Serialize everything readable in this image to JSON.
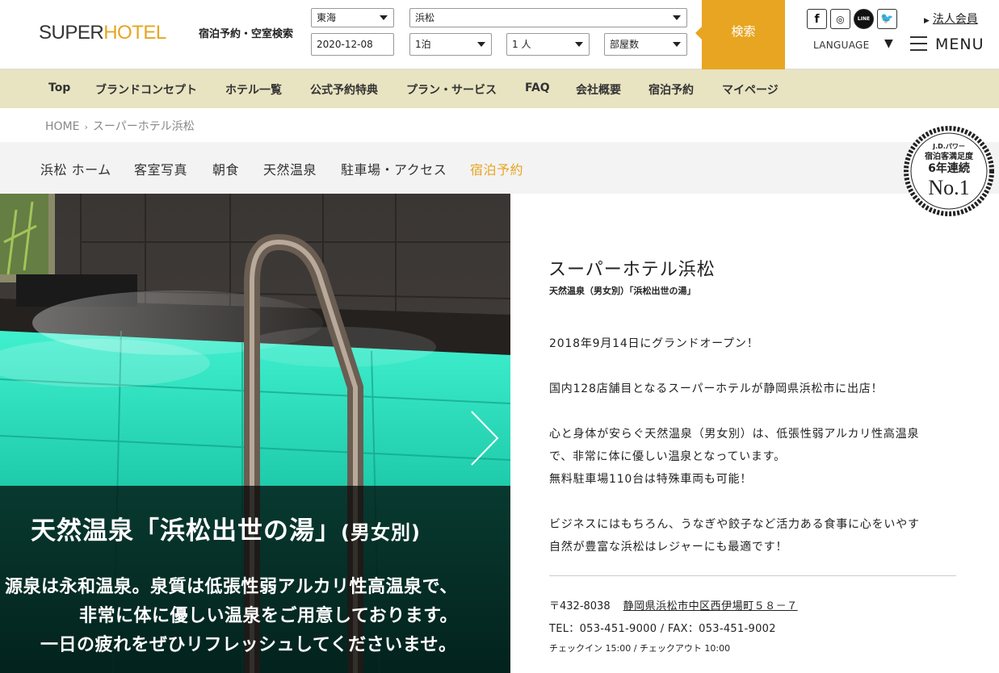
{
  "header": {
    "logo_main": "SUPER",
    "logo_accent": "HOTEL",
    "search_label": "宿泊予約・空室検索",
    "region_select": "東海",
    "city_select": "浜松",
    "checkin_date": "2020-12-08",
    "nights_select": "1泊",
    "guests_select": "1 人",
    "rooms_select": "部屋数",
    "search_button": "検索",
    "social": {
      "facebook": "f",
      "instagram": "◎",
      "line": "LINE",
      "twitter": "🐦"
    },
    "corporate_link": "法人会員",
    "language_label": "LANGUAGE",
    "language_caret": "▼",
    "menu_label": "MENU"
  },
  "global_nav": [
    "Top",
    "ブランドコンセプト",
    "ホテル一覧",
    "公式予約特典",
    "プラン・サービス",
    "FAQ",
    "会社概要",
    "宿泊予約",
    "マイページ"
  ],
  "breadcrumb": {
    "home": "HOME",
    "separator": "›",
    "current": "スーパーホテル浜松"
  },
  "sub_nav": [
    "浜松 ホーム",
    "客室写真",
    "朝食",
    "天然温泉",
    "駐車場・アクセス",
    "宿泊予約"
  ],
  "badge": {
    "line1": "J.D.パワー",
    "line2": "宿泊客満足度",
    "line3": "6年連続",
    "line4": "No.1"
  },
  "hero": {
    "title": "天然温泉「浜松出世の湯」",
    "title_suffix": "(男女別)",
    "body": [
      "源泉は永和温泉。泉質は低張性弱アルカリ性高温泉で、",
      "非常に体に優しい温泉をご用意しております。",
      "一日の疲れをぜひリフレッシュしてくださいませ。"
    ]
  },
  "info": {
    "hotel_name": "スーパーホテル浜松",
    "subtitle": "天然温泉（男女別）「浜松出世の湯」",
    "paragraphs": [
      "2018年9月14日にグランドオープン！",
      "国内128店舗目となるスーパーホテルが静岡県浜松市に出店！",
      "心と身体が安らぐ天然温泉（男女別）は、低張性弱アルカリ性高温泉",
      "で、非常に体に優しい温泉となっています。",
      "無料駐車場110台は特殊車両も可能！",
      "ビジネスにはもちろん、うなぎや餃子など活力ある食事に心をいやす",
      "自然が豊富な浜松はレジャーにも最適です！"
    ],
    "postal": "〒432-8038",
    "address": "静岡県浜松市中区西伊場町５８－７",
    "tel_fax": "TEL：053-451-9000 / FAX：053-451-9002",
    "checkin_checkout": "チェックイン 15:00 / チェックアウト 10:00"
  },
  "colors": {
    "accent": "#e8a521",
    "nav_bg": "#e8e3c1",
    "subnav_bg": "#f3f3f3",
    "water": "#1fd6b4"
  }
}
